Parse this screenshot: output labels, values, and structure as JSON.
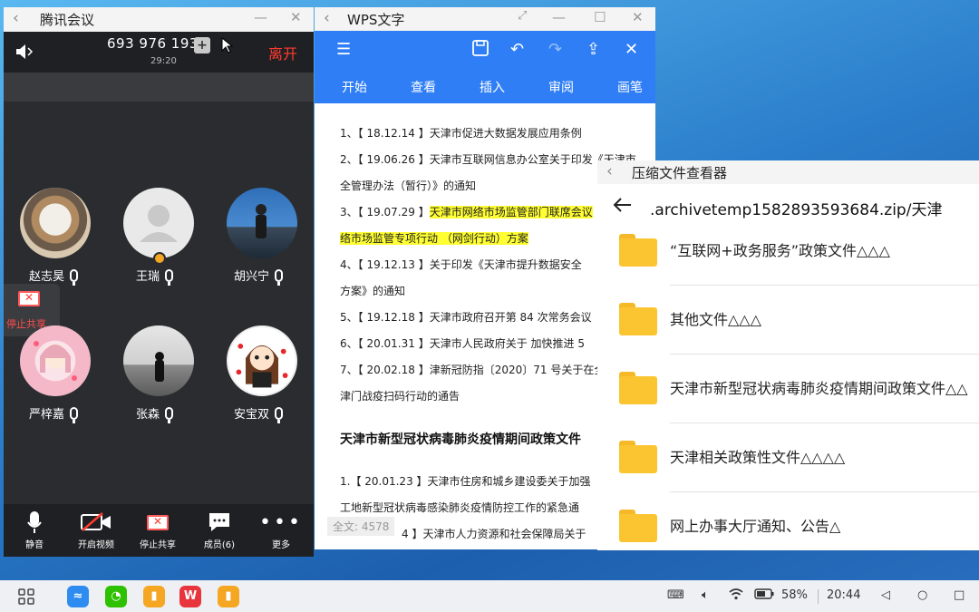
{
  "meeting": {
    "title": "腾讯会议",
    "meeting_id": "693 976 193",
    "timer": "29:20",
    "leave_label": "离开",
    "stop_share_label": "停止共享",
    "participants": [
      {
        "name": "赵志昊"
      },
      {
        "name": "王瑞"
      },
      {
        "name": "胡兴宁"
      },
      {
        "name": "严梓嘉"
      },
      {
        "name": "张森"
      },
      {
        "name": "安宝双"
      }
    ],
    "toolbar": {
      "mute": "静音",
      "video": "开启视频",
      "stop_share": "停止共享",
      "members": "成员(6)",
      "more": "更多"
    }
  },
  "wps": {
    "title": "WPS文字",
    "tabs": [
      "开始",
      "查看",
      "插入",
      "审阅",
      "画笔"
    ],
    "lines": [
      {
        "pre": "1、【 18.12.14 】天津市促进大数据发展应用条例",
        "hl": "",
        "post": ""
      },
      {
        "pre": "2、【 19.06.26 】天津市互联网信息办公室关于印发《天津市",
        "hl": "",
        "post": ""
      },
      {
        "pre": "全管理办法（暂行）》的通知",
        "hl": "",
        "post": ""
      },
      {
        "pre": "3、【 19.07.29 】",
        "hl": "天津市网络市场监管部门联席会议",
        "post": ""
      },
      {
        "pre": "",
        "hl": "络市场监管专项行动 （网剑行动）方案",
        "post": ""
      },
      {
        "pre": "4、【 19.12.13 】关于印发《天津市提升数据安全",
        "hl": "",
        "post": ""
      },
      {
        "pre": "方案》的通知",
        "hl": "",
        "post": ""
      },
      {
        "pre": "5、【 19.12.18 】天津市政府召开第 84 次常务会议",
        "hl": "",
        "post": ""
      },
      {
        "pre": "6、【 20.01.31 】天津市人民政府关于 加快推进 5",
        "hl": "",
        "post": ""
      },
      {
        "pre": "7、【 20.02.18 】津新冠防指〔2020〕71 号关于在全",
        "hl": "",
        "post": ""
      },
      {
        "pre": "津门战疫扫码行动的通告",
        "hl": "",
        "post": ""
      }
    ],
    "heading": "天津市新型冠状病毒肺炎疫情期间政策文件",
    "lines2": [
      "1.【 20.01.23 】天津市住房和城乡建设委关于加强",
      "工地新型冠状病毒感染肺炎疫情防控工作的紧急通",
      "4 】天津市人力资源和社会保障局关于"
    ],
    "word_count": "全文: 4578"
  },
  "archive": {
    "title": "压缩文件查看器",
    "path": ".archivetemp1582893593684.zip/天津",
    "items": [
      {
        "name": "“互联网+政务服务”政策文件△△△"
      },
      {
        "name": "其他文件△△△"
      },
      {
        "name": "天津市新型冠状病毒肺炎疫情期间政策文件△△"
      },
      {
        "name": "天津相关政策性文件△△△△"
      },
      {
        "name": "网上办事大厅通知、公告△"
      }
    ]
  },
  "taskbar": {
    "battery": "58%",
    "time": "20:44"
  },
  "colors": {
    "wps_blue": "#2f7ef5",
    "leave_red": "#ff3b30",
    "highlight": "#ffff33",
    "folder": "#fbc531"
  }
}
